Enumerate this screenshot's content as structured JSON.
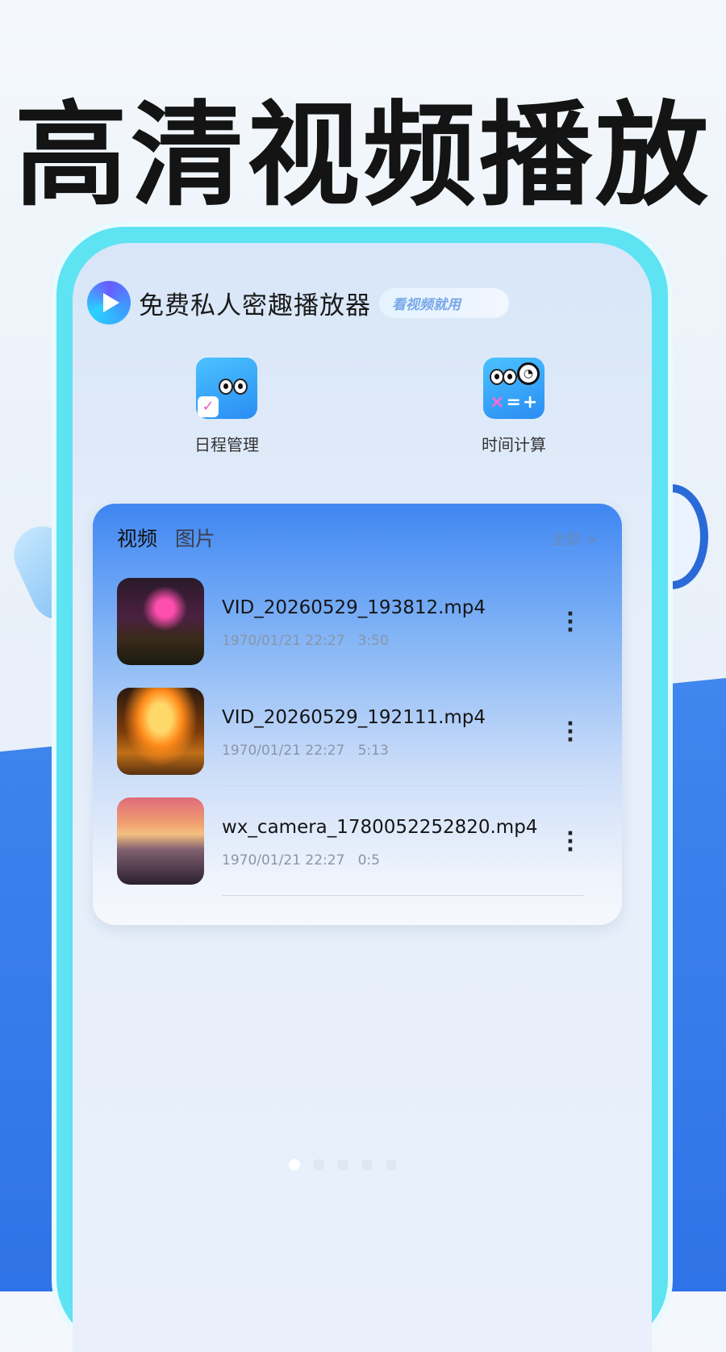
{
  "headline": "高清视频播放",
  "app": {
    "title": "免费私人密趣播放器",
    "badge": "看视频就用"
  },
  "shortcuts": [
    {
      "label": "日程管理",
      "icon": "calendar-check-icon"
    },
    {
      "label": "时间计算",
      "icon": "clock-calculator-icon"
    }
  ],
  "tabs": {
    "video": "视频",
    "image": "图片",
    "all": "全部 >"
  },
  "videos": [
    {
      "name": "VID_20260529_193812.mp4",
      "date": "1970/01/21 22:27",
      "duration": "3:50"
    },
    {
      "name": "VID_20260529_192111.mp4",
      "date": "1970/01/21 22:27",
      "duration": "5:13"
    },
    {
      "name": "wx_camera_1780052252820.mp4",
      "date": "1970/01/21 22:27",
      "duration": "0:5"
    }
  ],
  "pager": {
    "count": 5,
    "active": 0
  },
  "colors": {
    "accent": "#3f86f2",
    "frame": "#5ee3f3",
    "highlight": "#e05cd0"
  }
}
